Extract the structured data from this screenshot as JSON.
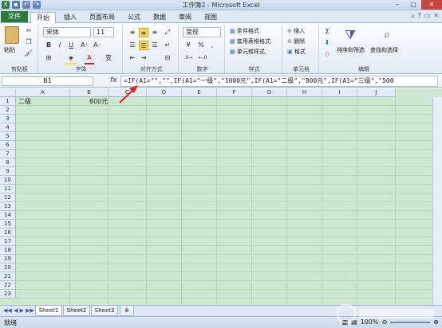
{
  "window": {
    "title": "工作簿2 - Microsoft Excel"
  },
  "ribbon_tabs": [
    {
      "label": "文件"
    },
    {
      "label": "开始"
    },
    {
      "label": "插入"
    },
    {
      "label": "页面布局"
    },
    {
      "label": "公式"
    },
    {
      "label": "数据"
    },
    {
      "label": "审阅"
    },
    {
      "label": "视图"
    }
  ],
  "ribbon": {
    "clipboard": {
      "label": "剪贴板",
      "paste": "粘贴"
    },
    "font": {
      "label": "字体",
      "name": "宋体",
      "size": "11",
      "bold": "B",
      "italic": "I",
      "underline": "U",
      "color_letter": "A",
      "phonetic": "变"
    },
    "alignment": {
      "label": "对齐方式"
    },
    "number": {
      "label": "数字",
      "format": "常规",
      "percent": "%",
      "comma": ","
    },
    "styles": {
      "label": "样式",
      "items": [
        "条件格式",
        "套用表格格式",
        "单元格样式"
      ]
    },
    "cells": {
      "label": "单元格",
      "items": [
        "插入",
        "删除",
        "格式"
      ]
    },
    "editing": {
      "label": "编辑",
      "sort": "排序和筛选",
      "find": "查找和选择",
      "sigma": "Σ"
    }
  },
  "formula_bar": {
    "name_box": "B1",
    "fx": "fx",
    "formula": "=IF(A1=\"\",\"\",IF(A1=\"一级\",\"1000元\",IF(A1=\"二级\",\"800元\",IF(A1=\"三级\",\"500"
  },
  "columns": [
    "A",
    "B",
    "C",
    "D",
    "E",
    "F",
    "G",
    "H",
    "I",
    "J"
  ],
  "rows": [
    "1",
    "2",
    "3",
    "4",
    "5",
    "6",
    "7",
    "8",
    "9",
    "10",
    "11",
    "12",
    "13",
    "14",
    "15",
    "16",
    "17",
    "18",
    "19",
    "20",
    "21",
    "22",
    "23"
  ],
  "cells": {
    "A1": "二级",
    "B1": "800元"
  },
  "sheets": [
    "Sheet1",
    "Sheet2",
    "Sheet3"
  ],
  "status": {
    "ready": "就绪",
    "zoom": "100%"
  },
  "colors": {
    "file_tab": "#2b7a3b",
    "grid_bg": "#cce8cf",
    "arrow": "#e02020"
  }
}
